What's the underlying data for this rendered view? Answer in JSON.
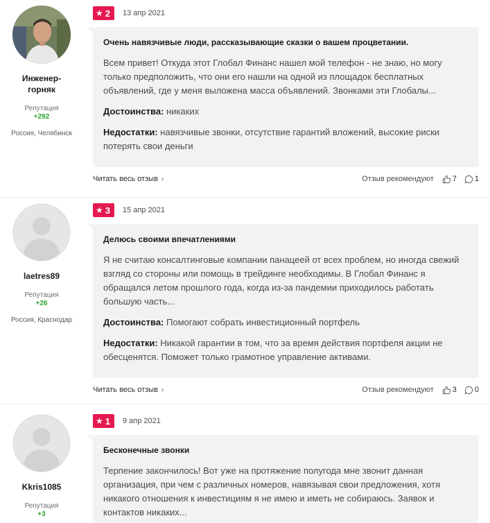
{
  "reviews": [
    {
      "author": "Инженер-горняк",
      "reputation_label": "Репутация",
      "reputation_value": "+292",
      "location": "Россия, Челябинск",
      "rating": "2",
      "date": "13 апр 2021",
      "title": "Очень навязчивые люди, рассказывающие сказки о вашем процветании.",
      "text": "Всем привет! Откуда этот Глобал Финанс нашел мой телефон - не знаю, но могу только предположить, что они его нашли на одной из площадок бесплатных объявлений, где у меня выложена масса объявлений. Звонками эти Глобалы...",
      "pros_label": "Достоинства:",
      "pros": "никаких",
      "cons_label": "Недостатки:",
      "cons": "навязчивые звонки, отсутствие гарантий вложений, высокие риски потерять свои деньги",
      "read_more": "Читать весь отзыв",
      "recommend": "Отзыв рекомендуют",
      "likes": "7",
      "comments": "1"
    },
    {
      "author": "laetres89",
      "reputation_label": "Репутация",
      "reputation_value": "+26",
      "location": "Россия, Краснодар",
      "rating": "3",
      "date": "15 апр 2021",
      "title": "Делюсь своими впечатлениями",
      "text": "Я не считаю консалтинговые компании панацеей от всех проблем, но иногда свежий взгляд со стороны или помощь в трейдинге необходимы. В Глобал Финанс я обращался летом прошлого года, когда из-за пандемии приходилось работать большую часть...",
      "pros_label": "Достоинства:",
      "pros": "Помогают собрать инвестиционный портфель",
      "cons_label": "Недостатки:",
      "cons": "Никакой гарантии в том, что за время действия портфеля акции не обесценятся. Поможет только грамотное управление активами.",
      "read_more": "Читать весь отзыв",
      "recommend": "Отзыв рекомендуют",
      "likes": "3",
      "comments": "0"
    },
    {
      "author": "Kkris1085",
      "reputation_label": "Репутация",
      "reputation_value": "+3",
      "location": "",
      "rating": "1",
      "date": "9 апр 2021",
      "title": "Бесконечные звонки",
      "text": "Терпение закончилось! Вот уже на протяжение полугода мне звонит данная организация, при чем с различных номеров, навязывая свои предложения, хотя никакого отношения к инвестициям я не имею и иметь не собираюсь. Заявок и контактов никаких..."
    }
  ],
  "colors": {
    "rating_badge": "#e4194f",
    "reputation": "#2aa52a",
    "bubble": "#f2f2f2"
  },
  "icons": {
    "star": "star-icon",
    "thumb": "thumbs-up-icon",
    "comment": "comment-icon",
    "chevron": "chevron-right-icon"
  }
}
